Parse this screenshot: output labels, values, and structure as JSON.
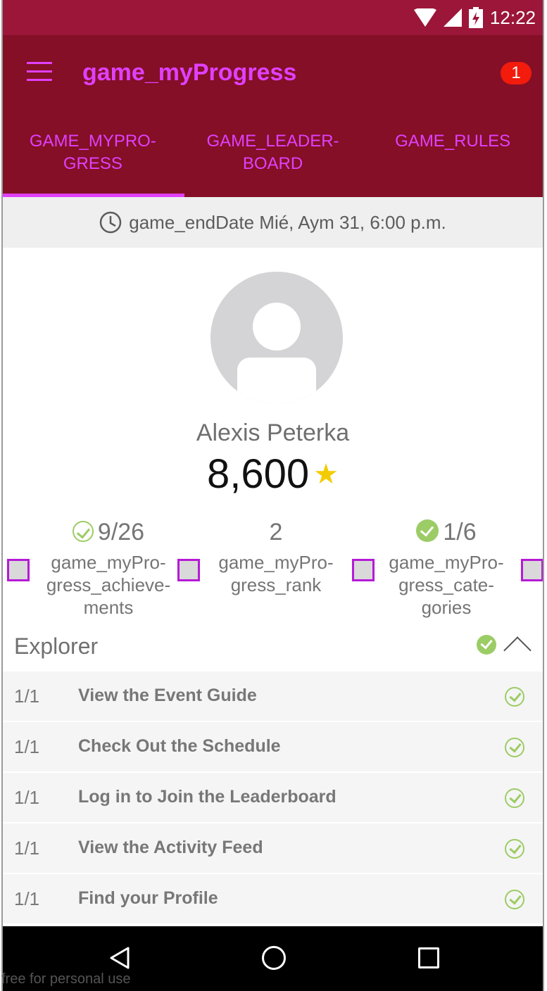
{
  "status_bar": {
    "time": "12:22",
    "icons": [
      "wifi-icon",
      "signal-icon",
      "battery-charging-icon"
    ]
  },
  "app_bar": {
    "title": "game_myProgress",
    "notification_count": "1"
  },
  "tabs": [
    {
      "line1": "GAME_MYPRO-",
      "line2": "GRESS",
      "selected": true
    },
    {
      "line1": "GAME_LEADER-",
      "line2": "BOARD",
      "selected": false
    },
    {
      "line1": "GAME_RULES",
      "line2": "",
      "selected": false
    }
  ],
  "end_date": {
    "text": "game_endDate Mié, Aym 31, 6:00 p.m."
  },
  "profile": {
    "name": "Alexis Peterka",
    "points": "8,600"
  },
  "stats": [
    {
      "value": "9/26",
      "label1": "game_myPro-",
      "label2": "gress_achieve-",
      "label3": "ments"
    },
    {
      "value": "2",
      "label1": "game_myPro-",
      "label2": "gress_rank",
      "label3": ""
    },
    {
      "value": "1/6",
      "label1": "game_myPro-",
      "label2": "gress_cate-",
      "label3": "gories"
    }
  ],
  "explorer": {
    "title": "Explorer",
    "items": [
      {
        "count": "1/1",
        "title": "View the Event Guide"
      },
      {
        "count": "1/1",
        "title": "Check Out the Schedule"
      },
      {
        "count": "1/1",
        "title": "Log in to Join the Leaderboard"
      },
      {
        "count": "1/1",
        "title": "View the Activity Feed"
      },
      {
        "count": "1/1",
        "title": "Find your Profile"
      }
    ]
  },
  "watermark": "free for personal use",
  "colors": {
    "status_bar": "#9b1639",
    "app_bar": "#840f26",
    "accent": "#e040fb",
    "check": "#9ccc65",
    "star": "#f2cc00",
    "badge": "#f21b0c"
  }
}
